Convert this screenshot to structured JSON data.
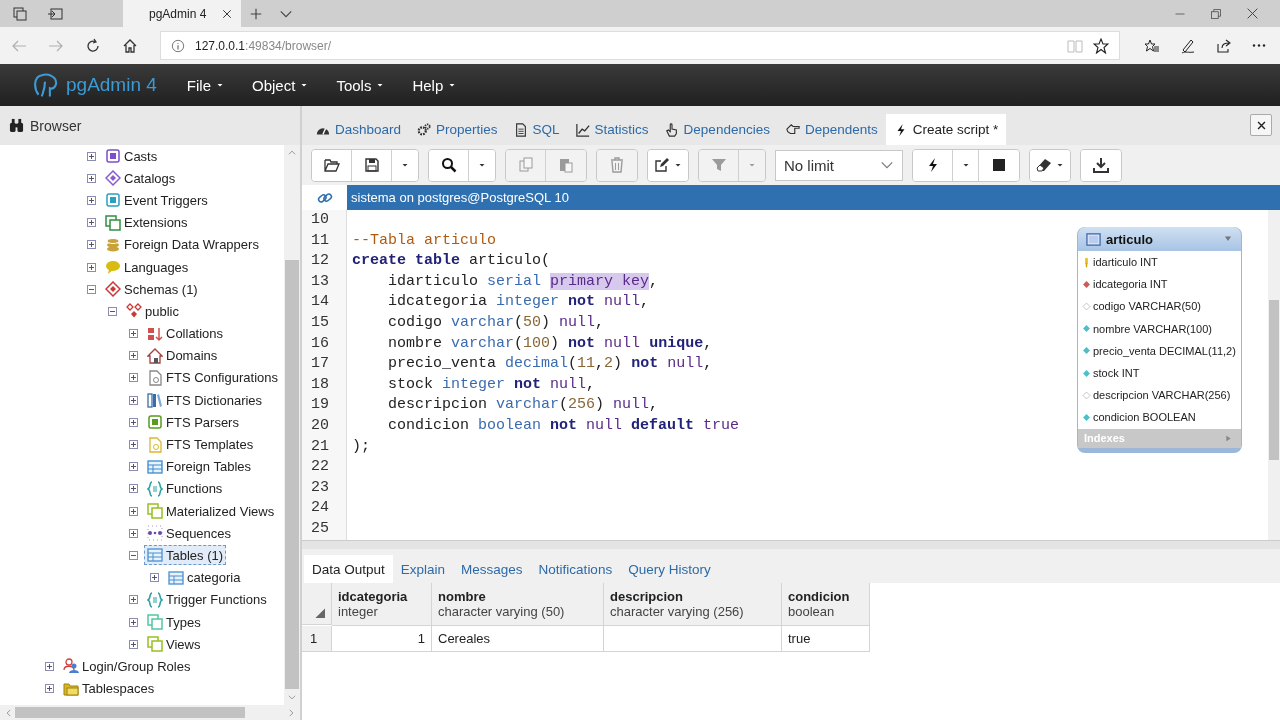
{
  "browser": {
    "tab_title": "pgAdmin 4",
    "url": {
      "host": "127.0.0.1",
      "rest": ":49834/browser/"
    }
  },
  "app": {
    "brand": "pgAdmin 4",
    "menus": [
      "File",
      "Object",
      "Tools",
      "Help"
    ]
  },
  "browser_panel": {
    "title": "Browser"
  },
  "tree": {
    "items": [
      {
        "children": [
          {
            "children": [
              {
                "label": "Casts",
                "kind": "casts",
                "expanded": false,
                "selected": false
              },
              {
                "label": "Catalogs",
                "kind": "catalog",
                "expanded": false,
                "selected": false
              },
              {
                "label": "Event Triggers",
                "kind": "trigger",
                "expanded": false,
                "selected": false
              },
              {
                "label": "Extensions",
                "kind": "extension",
                "expanded": false,
                "selected": false
              },
              {
                "label": "Foreign Data Wrappers",
                "kind": "fdw",
                "expanded": false,
                "selected": false
              },
              {
                "label": "Languages",
                "kind": "language",
                "expanded": false,
                "selected": false
              },
              {
                "label": "Schemas (1)",
                "kind": "schema",
                "expanded": true,
                "selected": false,
                "children": [
                  {
                    "label": "public",
                    "kind": "namespace",
                    "expanded": true,
                    "selected": false,
                    "children": [
                      {
                        "label": "Collations",
                        "kind": "collation",
                        "expanded": false,
                        "selected": false
                      },
                      {
                        "label": "Domains",
                        "kind": "domain",
                        "expanded": false,
                        "selected": false
                      },
                      {
                        "label": "FTS Configurations",
                        "kind": "ftsconfig",
                        "expanded": false,
                        "selected": false
                      },
                      {
                        "label": "FTS Dictionaries",
                        "kind": "ftsdict",
                        "expanded": false,
                        "selected": false
                      },
                      {
                        "label": "FTS Parsers",
                        "kind": "ftsparser",
                        "expanded": false,
                        "selected": false
                      },
                      {
                        "label": "FTS Templates",
                        "kind": "ftstemplate",
                        "expanded": false,
                        "selected": false
                      },
                      {
                        "label": "Foreign Tables",
                        "kind": "foreigntable",
                        "expanded": false,
                        "selected": false
                      },
                      {
                        "label": "Functions",
                        "kind": "function",
                        "expanded": false,
                        "selected": false
                      },
                      {
                        "label": "Materialized Views",
                        "kind": "matview",
                        "expanded": false,
                        "selected": false
                      },
                      {
                        "label": "Sequences",
                        "kind": "sequence",
                        "expanded": false,
                        "selected": false
                      },
                      {
                        "label": "Tables (1)",
                        "kind": "table",
                        "expanded": true,
                        "selected": true,
                        "children": [
                          {
                            "label": "categoria",
                            "kind": "table",
                            "expanded": false,
                            "selected": false
                          }
                        ]
                      },
                      {
                        "label": "Trigger Functions",
                        "kind": "triggerfn",
                        "expanded": false,
                        "selected": false
                      },
                      {
                        "label": "Types",
                        "kind": "type",
                        "expanded": false,
                        "selected": false
                      },
                      {
                        "label": "Views",
                        "kind": "view",
                        "expanded": false,
                        "selected": false
                      }
                    ]
                  }
                ]
              }
            ]
          }
        ]
      },
      {
        "label": "Login/Group Roles",
        "kind": "role",
        "expanded": false,
        "selected": false
      },
      {
        "label": "Tablespaces",
        "kind": "tablespace",
        "expanded": false,
        "selected": false
      }
    ]
  },
  "tabs": [
    {
      "label": "Dashboard",
      "selected": false
    },
    {
      "label": "Properties",
      "selected": false
    },
    {
      "label": "SQL",
      "selected": false
    },
    {
      "label": "Statistics",
      "selected": false
    },
    {
      "label": "Dependencies",
      "selected": false
    },
    {
      "label": "Dependents",
      "selected": false
    },
    {
      "label": "Create script *",
      "selected": true
    }
  ],
  "toolbar": {
    "groups": [
      [
        {
          "kind": "open",
          "disabled": false
        },
        {
          "kind": "save",
          "disabled": false
        },
        {
          "kind": "caret",
          "disabled": false
        }
      ],
      [
        {
          "kind": "search",
          "disabled": false
        },
        {
          "kind": "caret",
          "disabled": false
        }
      ],
      [
        {
          "kind": "copy",
          "disabled": true
        },
        {
          "kind": "paste",
          "disabled": true
        }
      ],
      [
        {
          "kind": "delete",
          "disabled": true
        }
      ],
      [
        {
          "kind": "edit",
          "disabled": false
        }
      ],
      [
        {
          "kind": "filter",
          "disabled": true
        },
        {
          "kind": "caret",
          "disabled": true
        }
      ],
      [
        {
          "kind": "limit",
          "value": "No limit",
          "disabled": false
        }
      ],
      [
        {
          "kind": "execute",
          "disabled": false
        },
        {
          "kind": "caret",
          "disabled": false
        },
        {
          "kind": "stop",
          "disabled": false
        }
      ],
      [
        {
          "kind": "clear",
          "disabled": false
        }
      ],
      [
        {
          "kind": "download",
          "disabled": false
        }
      ]
    ]
  },
  "connection": "sistema on postgres@PostgreSQL 10",
  "editor": {
    "lines": [
      {
        "number": "10"
      },
      {
        "number": "11",
        "tokens": [
          {
            "text": "--Tabla articulo",
            "kind": "comment"
          }
        ]
      },
      {
        "number": "12",
        "tokens": [
          {
            "text": "create ",
            "kind": "keyword"
          },
          {
            "text": "table",
            "kind": "keyword"
          },
          {
            "text": " articulo(",
            "kind": "plain"
          }
        ]
      },
      {
        "number": "13",
        "tokens": [
          {
            "text": "    idarticulo ",
            "kind": "plain"
          },
          {
            "text": "serial ",
            "kind": "type"
          },
          {
            "text": "primary key",
            "kind": "selection"
          },
          {
            "text": ",",
            "kind": "plain"
          }
        ]
      },
      {
        "number": "14",
        "tokens": [
          {
            "text": "    idcategoria ",
            "kind": "plain"
          },
          {
            "text": "integer ",
            "kind": "type"
          },
          {
            "text": "not ",
            "kind": "keyword"
          },
          {
            "text": "null",
            "kind": "atom"
          },
          {
            "text": ",",
            "kind": "plain"
          }
        ]
      },
      {
        "number": "15",
        "tokens": [
          {
            "text": "    codigo ",
            "kind": "plain"
          },
          {
            "text": "varchar",
            "kind": "type"
          },
          {
            "text": "(",
            "kind": "plain"
          },
          {
            "text": "50",
            "kind": "number"
          },
          {
            "text": ") ",
            "kind": "plain"
          },
          {
            "text": "null",
            "kind": "atom"
          },
          {
            "text": ",",
            "kind": "plain"
          }
        ]
      },
      {
        "number": "16",
        "tokens": [
          {
            "text": "    nombre ",
            "kind": "plain"
          },
          {
            "text": "varchar",
            "kind": "type"
          },
          {
            "text": "(",
            "kind": "plain"
          },
          {
            "text": "100",
            "kind": "number"
          },
          {
            "text": ") ",
            "kind": "plain"
          },
          {
            "text": "not ",
            "kind": "keyword"
          },
          {
            "text": "null ",
            "kind": "atom"
          },
          {
            "text": "unique",
            "kind": "keyword"
          },
          {
            "text": ",",
            "kind": "plain"
          }
        ]
      },
      {
        "number": "17",
        "tokens": [
          {
            "text": "    precio_venta ",
            "kind": "plain"
          },
          {
            "text": "decimal",
            "kind": "type"
          },
          {
            "text": "(",
            "kind": "plain"
          },
          {
            "text": "11",
            "kind": "number"
          },
          {
            "text": ",",
            "kind": "plain"
          },
          {
            "text": "2",
            "kind": "number"
          },
          {
            "text": ") ",
            "kind": "plain"
          },
          {
            "text": "not ",
            "kind": "keyword"
          },
          {
            "text": "null",
            "kind": "atom"
          },
          {
            "text": ",",
            "kind": "plain"
          }
        ]
      },
      {
        "number": "18",
        "tokens": [
          {
            "text": "    stock ",
            "kind": "plain"
          },
          {
            "text": "integer ",
            "kind": "type"
          },
          {
            "text": "not ",
            "kind": "keyword"
          },
          {
            "text": "null",
            "kind": "atom"
          },
          {
            "text": ",",
            "kind": "plain"
          }
        ]
      },
      {
        "number": "19",
        "tokens": [
          {
            "text": "    descripcion ",
            "kind": "plain"
          },
          {
            "text": "varchar",
            "kind": "type"
          },
          {
            "text": "(",
            "kind": "plain"
          },
          {
            "text": "256",
            "kind": "number"
          },
          {
            "text": ") ",
            "kind": "plain"
          },
          {
            "text": "null",
            "kind": "atom"
          },
          {
            "text": ",",
            "kind": "plain"
          }
        ]
      },
      {
        "number": "20",
        "tokens": [
          {
            "text": "    condicion ",
            "kind": "plain"
          },
          {
            "text": "boolean ",
            "kind": "type"
          },
          {
            "text": "not ",
            "kind": "keyword"
          },
          {
            "text": "null ",
            "kind": "atom"
          },
          {
            "text": "default ",
            "kind": "keyword"
          },
          {
            "text": "true",
            "kind": "atom"
          }
        ]
      },
      {
        "number": "21",
        "tokens": [
          {
            "text": ");",
            "kind": "plain"
          }
        ]
      },
      {
        "number": "22"
      },
      {
        "number": "23"
      },
      {
        "number": "24"
      },
      {
        "number": "25"
      }
    ]
  },
  "diagram": {
    "title": "articulo",
    "columns": [
      {
        "text": "idarticulo INT",
        "kind": "primary"
      },
      {
        "text": "idcategoria INT",
        "kind": "foreign"
      },
      {
        "text": "codigo VARCHAR(50)",
        "kind": "nullable"
      },
      {
        "text": "nombre VARCHAR(100)",
        "kind": "notnull"
      },
      {
        "text": "precio_venta DECIMAL(11,2)",
        "kind": "notnull"
      },
      {
        "text": "stock INT",
        "kind": "notnull"
      },
      {
        "text": "descripcion VARCHAR(256)",
        "kind": "nullable"
      },
      {
        "text": "condicion BOOLEAN",
        "kind": "notnull"
      }
    ],
    "footer": "Indexes"
  },
  "results": {
    "tabs": [
      {
        "label": "Data Output",
        "selected": true
      },
      {
        "label": "Explain",
        "selected": false
      },
      {
        "label": "Messages",
        "selected": false
      },
      {
        "label": "Notifications",
        "selected": false
      },
      {
        "label": "Query History",
        "selected": false
      }
    ],
    "columns": [
      {
        "name": "idcategoria",
        "type": "integer",
        "kind": "numeric"
      },
      {
        "name": "nombre",
        "type": "character varying (50)",
        "kind": "text"
      },
      {
        "name": "descripcion",
        "type": "character varying (256)",
        "kind": "text"
      },
      {
        "name": "condicion",
        "type": "boolean",
        "kind": "text"
      }
    ],
    "rows": [
      {
        "number": "1",
        "cells": [
          "1",
          "Cereales",
          null,
          "true"
        ]
      }
    ]
  }
}
